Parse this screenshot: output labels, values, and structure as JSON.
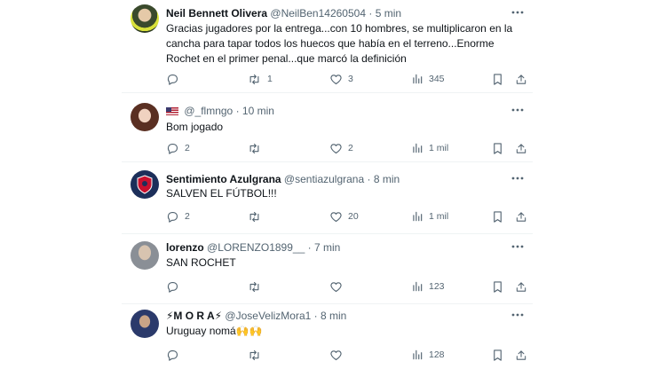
{
  "tweets": [
    {
      "name": "Neil Bennett Olivera",
      "handle": "@NeilBen14260504",
      "time": "5 min",
      "text": "Gracias jugadores por la entrega...con 10 hombres, se multiplicaron en la cancha para tapar todos los huecos que había en el terreno...Enorme Rochet en el primer penal...que marcó la definición",
      "replies": "",
      "reposts": "1",
      "likes": "3",
      "views": "345"
    },
    {
      "name": "",
      "handle": "@_flmngo",
      "time": "10 min",
      "text": "Bom jogado",
      "replies": "2",
      "reposts": "",
      "likes": "2",
      "views": "1 mil"
    },
    {
      "name": "Sentimiento Azulgrana",
      "handle": "@sentiazulgrana",
      "time": "8 min",
      "text": "SALVEN EL FÚTBOL!!!",
      "replies": "2",
      "reposts": "",
      "likes": "20",
      "views": "1 mil"
    },
    {
      "name": "lorenzo",
      "handle": "@LORENZO1899__",
      "time": "7 min",
      "text": "SAN ROCHET",
      "replies": "",
      "reposts": "",
      "likes": "",
      "views": "123"
    },
    {
      "name": "⚡M O R A⚡",
      "handle": "@JoseVelizMora1",
      "time": "8 min",
      "text": "Uruguay nomá🙌🙌",
      "replies": "",
      "reposts": "",
      "likes": "",
      "views": "128"
    }
  ],
  "separator": "·",
  "colors": {
    "text": "#0f1419",
    "secondary": "#536471",
    "divider": "#eff3f4"
  }
}
